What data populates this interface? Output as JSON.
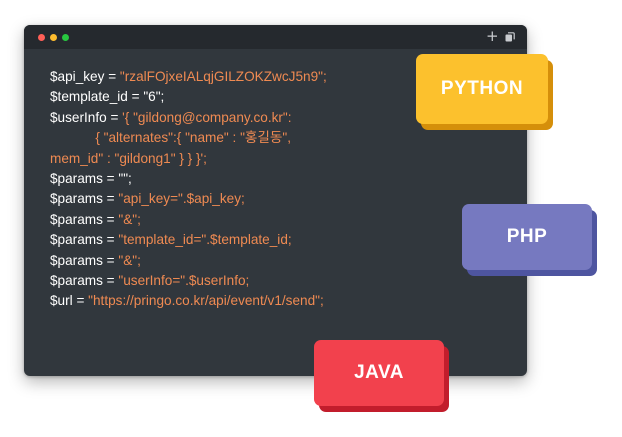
{
  "window": {
    "controls": [
      "close",
      "minimize",
      "maximize"
    ],
    "actions": [
      {
        "icon": "plus-icon",
        "glyph": "+"
      },
      {
        "icon": "copy-icon"
      }
    ]
  },
  "code_lines": [
    [
      {
        "t": "$api_key = ",
        "k": "p"
      },
      {
        "t": "\"rzalFOjxeIALqjGILZOKZwcJ5n9\";",
        "k": "s"
      }
    ],
    [
      {
        "t": "$template_id = \"6\";",
        "k": "p"
      }
    ],
    [
      {
        "t": "$userInfo = ",
        "k": "p"
      },
      {
        "t": "'{ \"gildong@company.co.kr\":",
        "k": "s"
      }
    ],
    [
      {
        "t": "            { \"alternates\":{ \"name\" : \"홍길동\",",
        "k": "s"
      }
    ],
    [
      {
        "t": "mem_id\" : \"gildong1\" } } }';",
        "k": "s"
      }
    ],
    [
      {
        "t": "$params = \"\";",
        "k": "p"
      }
    ],
    [
      {
        "t": "$params = ",
        "k": "p"
      },
      {
        "t": "\"api_key=\".$api_key;",
        "k": "s"
      }
    ],
    [
      {
        "t": "$params = ",
        "k": "p"
      },
      {
        "t": "\"&\";",
        "k": "s"
      }
    ],
    [
      {
        "t": "$params = ",
        "k": "p"
      },
      {
        "t": "\"template_id=\".$template_id;",
        "k": "s"
      }
    ],
    [
      {
        "t": "$params = ",
        "k": "p"
      },
      {
        "t": "\"&\";",
        "k": "s"
      }
    ],
    [
      {
        "t": "$params = ",
        "k": "p"
      },
      {
        "t": "\"userInfo=\".$userInfo;",
        "k": "s"
      }
    ],
    [
      {
        "t": "$url = ",
        "k": "p"
      },
      {
        "t": "\"https://pringo.co.kr/api/event/v1/send\";",
        "k": "s"
      }
    ]
  ],
  "badges": {
    "python": "PYTHON",
    "php": "PHP",
    "java": "JAVA"
  },
  "colors": {
    "editor_bg": "#31373d",
    "titlebar_bg": "#25292e",
    "string": "#ef8a52",
    "plain": "#ffffff",
    "python": "#fcc12d",
    "php": "#7679c0",
    "java": "#f2414d"
  }
}
